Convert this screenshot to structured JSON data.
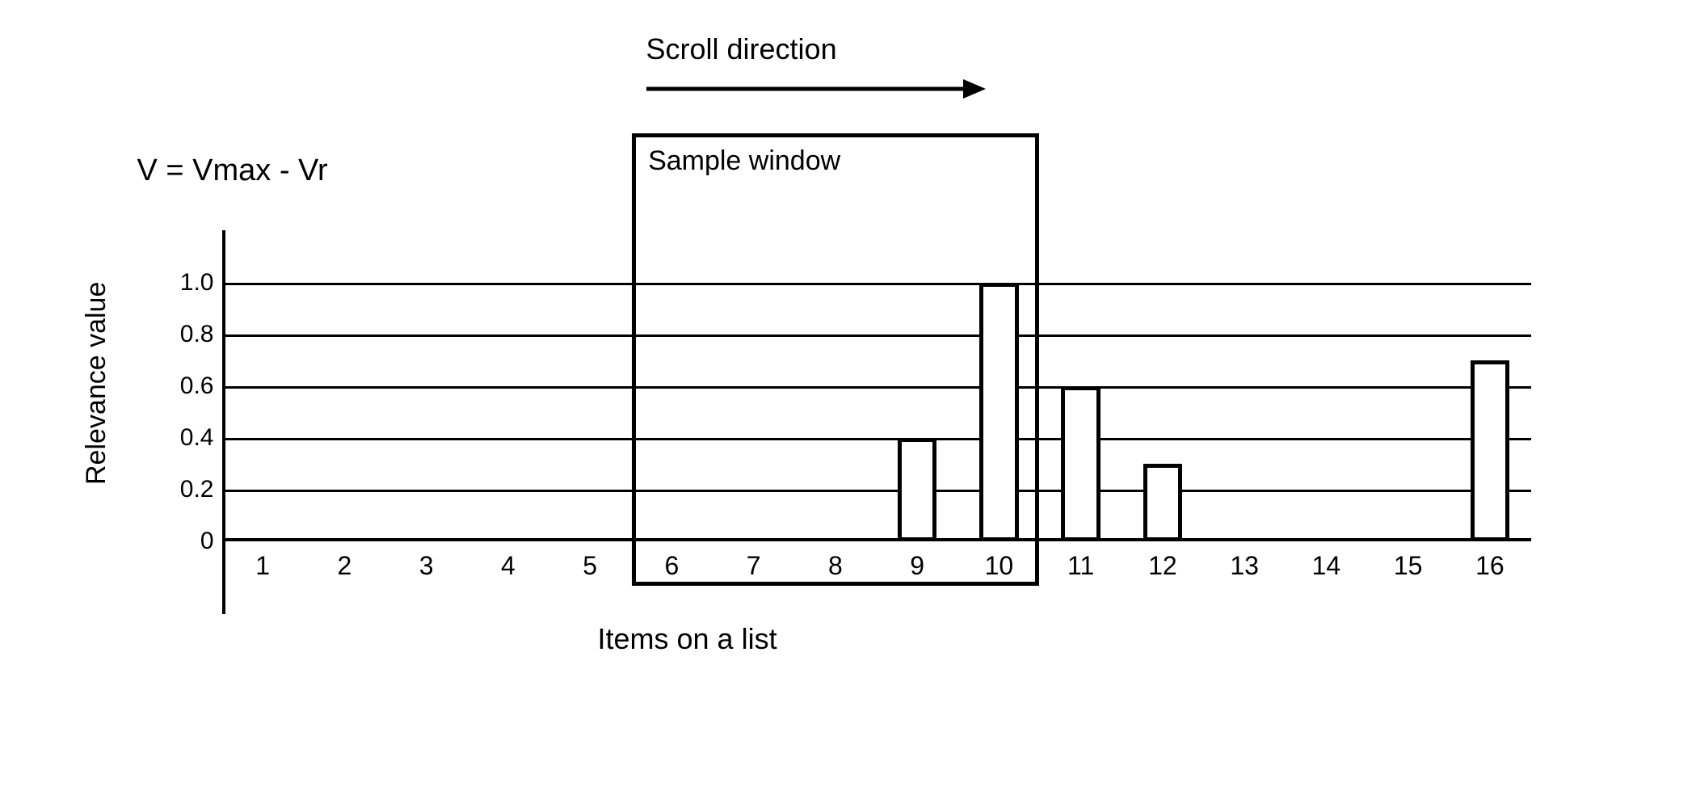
{
  "chart_data": {
    "type": "bar",
    "title": "",
    "xlabel": "Items on a list",
    "ylabel": "Relevance value",
    "ylim": [
      0,
      1.0
    ],
    "y_ticks": [
      0,
      0.2,
      0.4,
      0.6,
      0.8,
      1.0
    ],
    "categories": [
      "1",
      "2",
      "3",
      "4",
      "5",
      "6",
      "7",
      "8",
      "9",
      "10",
      "11",
      "12",
      "13",
      "14",
      "15",
      "16"
    ],
    "values": [
      0,
      0,
      0,
      0,
      0,
      0,
      0,
      0,
      0.4,
      1.0,
      0.6,
      0.3,
      0,
      0,
      0,
      0.7
    ],
    "annotations": {
      "scroll_direction": "Scroll direction",
      "sample_window": "Sample window",
      "formula": "V = Vmax - Vr",
      "sample_window_range": [
        6,
        10
      ]
    }
  }
}
